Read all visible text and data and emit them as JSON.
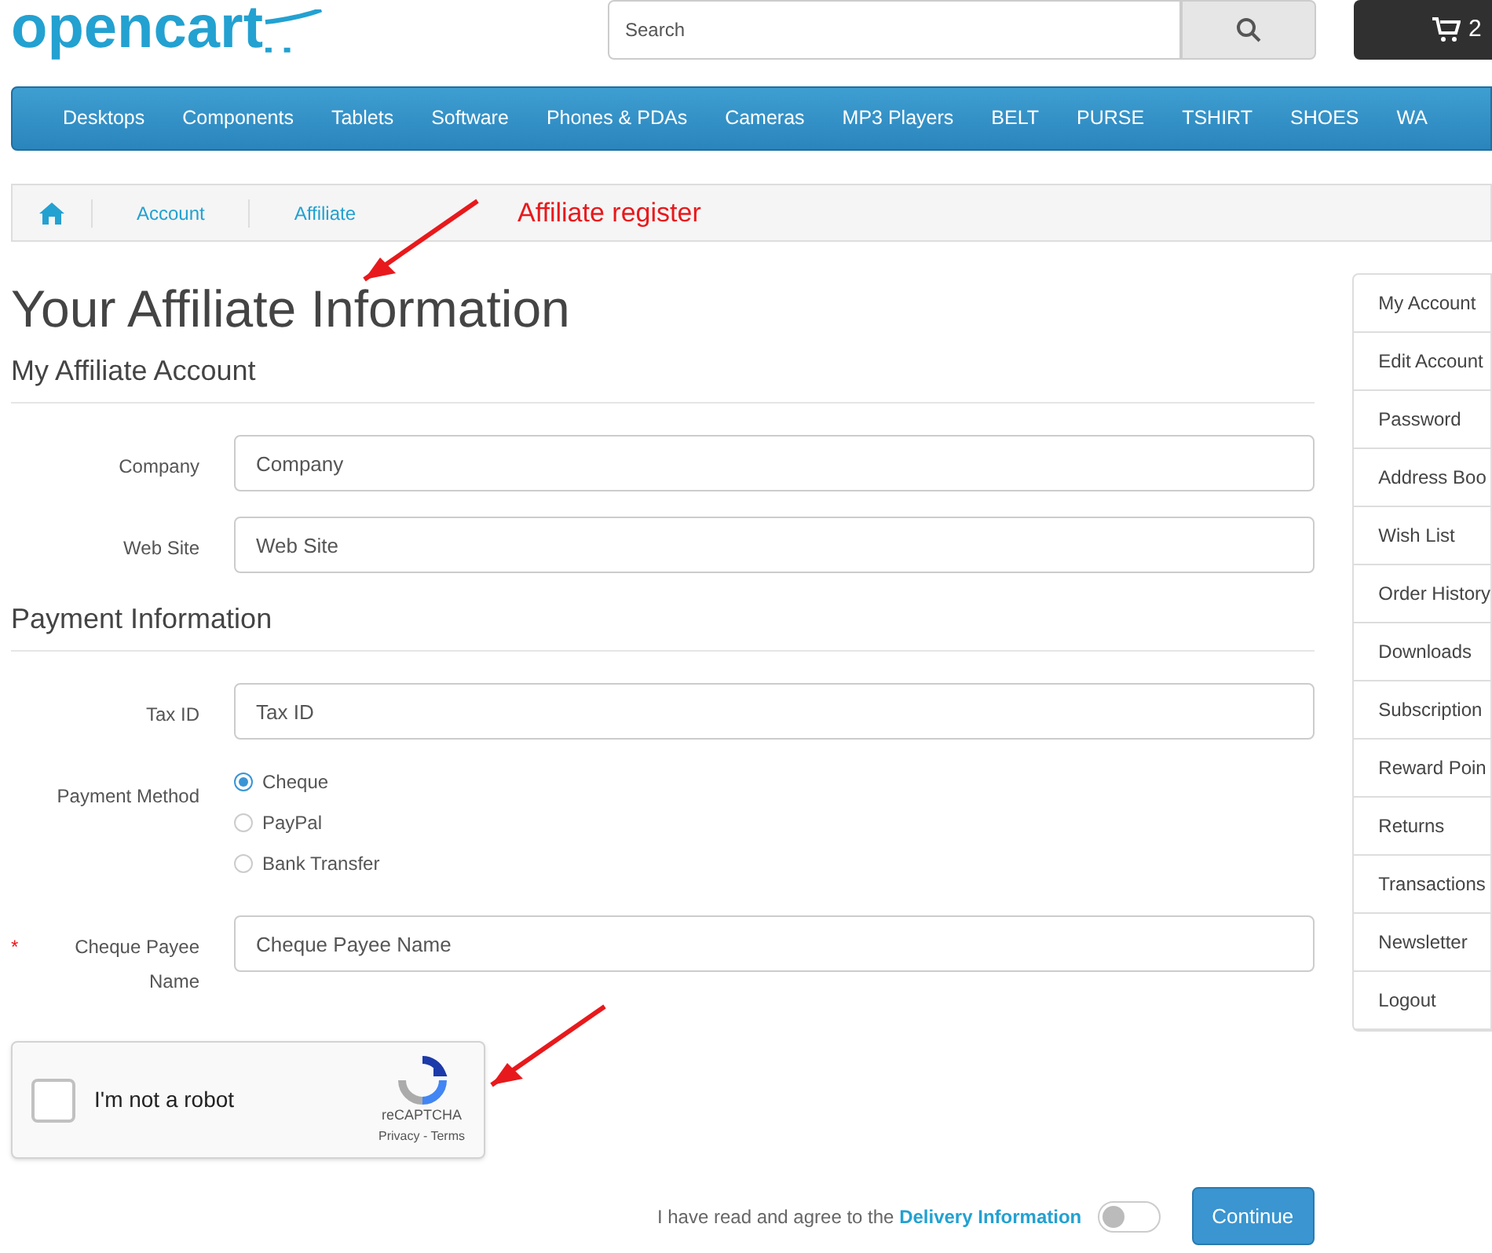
{
  "header": {
    "logo": "opencart",
    "search": {
      "placeholder": "Search"
    },
    "cart": {
      "count": "2"
    }
  },
  "nav": [
    "Desktops",
    "Components",
    "Tablets",
    "Software",
    "Phones & PDAs",
    "Cameras",
    "MP3 Players",
    "BELT",
    "PURSE",
    "TSHIRT",
    "SHOES",
    "WA"
  ],
  "breadcrumb": [
    "Account",
    "Affiliate"
  ],
  "annotations": [
    "Affiliate register"
  ],
  "title": "Your Affiliate Information",
  "sections": [
    {
      "title": "My Affiliate Account",
      "fields": [
        {
          "kind": "text",
          "label": "Company",
          "placeholder": "Company"
        },
        {
          "kind": "text",
          "label": "Web Site",
          "placeholder": "Web Site"
        }
      ]
    },
    {
      "title": "Payment Information",
      "fields": [
        {
          "kind": "text",
          "label": "Tax ID",
          "placeholder": "Tax ID"
        },
        {
          "kind": "radio",
          "label": "Payment Method",
          "options": [
            {
              "label": "Cheque",
              "selected": true
            },
            {
              "label": "PayPal",
              "selected": false
            },
            {
              "label": "Bank Transfer",
              "selected": false
            }
          ]
        },
        {
          "kind": "text",
          "label": "Cheque Payee Name",
          "required_mark": "*",
          "placeholder": "Cheque Payee Name"
        }
      ]
    }
  ],
  "captcha": {
    "checked": false,
    "label": "I'm not a robot",
    "brand": "reCAPTCHA",
    "links": "Privacy - Terms"
  },
  "agree": {
    "text": "I have read and agree to the",
    "link": "Delivery Information",
    "on": false
  },
  "continue": "Continue",
  "sidebar": [
    "My Account",
    "Edit Account",
    "Password",
    "Address Boo",
    "Wish List",
    "Order History",
    "Downloads",
    "Subscription",
    "Reward Poin",
    "Returns",
    "Transactions",
    "Newsletter",
    "Logout"
  ]
}
